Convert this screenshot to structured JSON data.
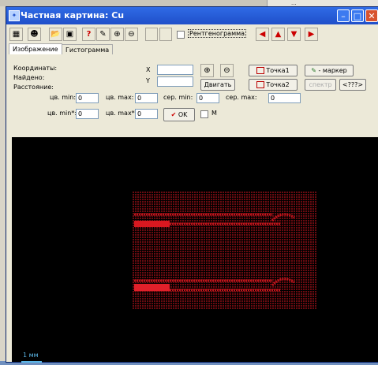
{
  "background": {
    "panel_text": "..."
  },
  "window": {
    "title": "Частная картина: Cu"
  },
  "toolbar": {
    "checkbox_label": "Рентгенограмма",
    "help_label": "?"
  },
  "tabs": [
    {
      "label": "Изображение"
    },
    {
      "label": "Гистограмма"
    }
  ],
  "info": {
    "coords_label": "Координаты:",
    "found_label": "Найдено:",
    "distance_label": "Расстояние:",
    "x_label": "X",
    "y_label": "Y",
    "x_value": "",
    "y_value": ""
  },
  "buttons": {
    "move": "Двигать",
    "point1": "Точка1",
    "point2": "Точка2",
    "marker": "- маркер",
    "spectrum": "спектр",
    "query": "<???>",
    "ok": "OK"
  },
  "params": {
    "intensity_min_label": "цв. min:",
    "intensity_min": "0",
    "intensity_max_label": "цв. max:",
    "intensity_max": "0",
    "avg_min_label": "сер. min:",
    "avg_min": "0",
    "avg_max_label": "сер. max:",
    "avg_max": "0",
    "intensity_min2_label": "цв. min*:",
    "intensity_min2": "0",
    "intensity_max2_label": "цв. max*:",
    "intensity_max2": "0",
    "m_label": "M"
  },
  "image": {
    "scale_label": "1 мм",
    "map_color": "#c0141b"
  }
}
